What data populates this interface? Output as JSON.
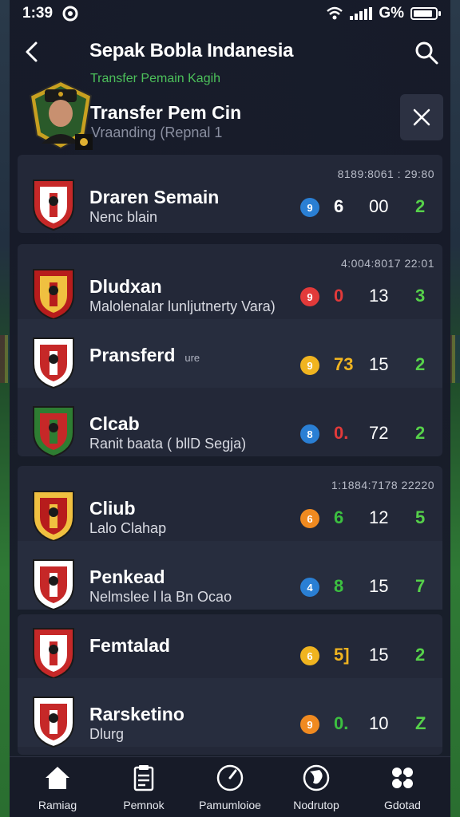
{
  "status_bar": {
    "time": "1:39",
    "battery": "G%",
    "battery_level": 0.9
  },
  "header": {
    "title": "Sepak Bobla Indanesia",
    "subtitle": "Transfer Pemain Kagih"
  },
  "transfer_header": {
    "title": "Transfer Pem Cin",
    "subtitle": "Vraanding (Repnal 1"
  },
  "rows": [
    {
      "name": "Draren Semain",
      "sub": "Nenc blain",
      "tag": "",
      "time": "8189:8061 : 29:80",
      "dot_color": "#2a7fd4",
      "dot_label": "9",
      "v1": "6",
      "v1_color": "#ffffff",
      "v2": "00",
      "v3": "2"
    },
    {
      "name": "Dludxan",
      "sub": "Malolenalar lunljutnerty Vara)",
      "tag": "",
      "time": "4:004:8017 22:01",
      "dot_color": "#e23a3a",
      "dot_label": "9",
      "v1": "0",
      "v1_color": "#e23a3a",
      "v2": "13",
      "v3": "3"
    },
    {
      "name": "Pransferd",
      "sub": "",
      "tag": "ure",
      "time": "",
      "dot_color": "#f0b420",
      "dot_label": "9",
      "v1": "73",
      "v1_color": "#f0b420",
      "v2": "15",
      "v3": "2"
    },
    {
      "name": "Clcab",
      "sub": "Ranit baata ( bllD Segja)",
      "tag": "",
      "time": "",
      "dot_color": "#2a7fd4",
      "dot_label": "8",
      "v1": "0.",
      "v1_color": "#e23a3a",
      "v2": "72",
      "v3": "2"
    },
    {
      "name": "Cliub",
      "sub": "Lalo Clahap",
      "tag": "",
      "time": "1:1884:7178 22220",
      "dot_color": "#f08a20",
      "dot_label": "6",
      "v1": "6",
      "v1_color": "#3cc040",
      "v2": "12",
      "v3": "5"
    },
    {
      "name": "Penkead",
      "sub": "Nelmslee l la Bn Ocao",
      "tag": "",
      "time": "",
      "dot_color": "#2a7fd4",
      "dot_label": "4",
      "v1": "8",
      "v1_color": "#3cc040",
      "v2": "15",
      "v3": "7"
    },
    {
      "name": "Femtalad",
      "sub": "",
      "tag": "",
      "time": "",
      "dot_color": "#f0b420",
      "dot_label": "6",
      "v1": "5]",
      "v1_color": "#f0b420",
      "v2": "15",
      "v3": "2"
    },
    {
      "name": "Rarsketino",
      "sub": "Dlurg",
      "tag": "",
      "time": "",
      "dot_color": "#f08a20",
      "dot_label": "9",
      "v1": "0.",
      "v1_color": "#3cc040",
      "v2": "10",
      "v3": "Z"
    }
  ],
  "nav": [
    {
      "label": "Ramiag",
      "icon": "home-icon"
    },
    {
      "label": "Pemnok",
      "icon": "clipboard-icon"
    },
    {
      "label": "Pamumloioe",
      "icon": "gauge-icon"
    },
    {
      "label": "Nodrutop",
      "icon": "globe-icon"
    },
    {
      "label": "Gdotad",
      "icon": "settings-icon"
    }
  ]
}
